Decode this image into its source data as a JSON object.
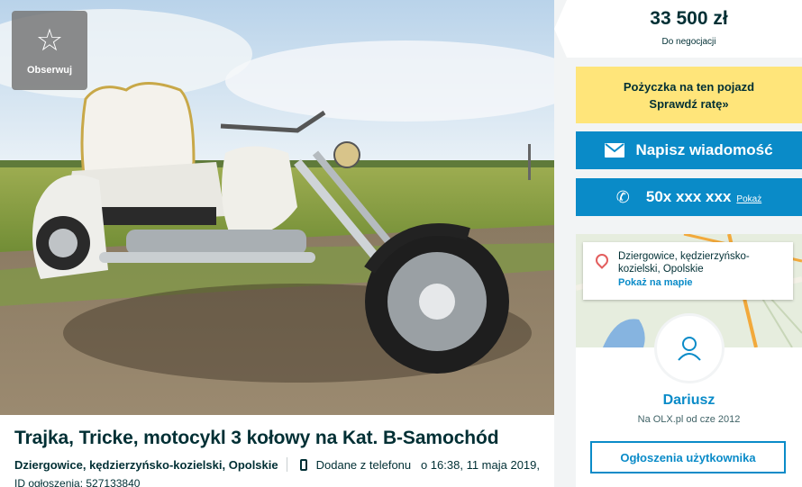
{
  "photo": {
    "observe_label": "Obserwuj",
    "observe_icon": "star-icon"
  },
  "listing": {
    "title": "Trajka, Tricke, motocykl 3 kołowy na Kat. B-Samochód",
    "location": "Dziergowice, kędzierzyńsko-kozielski, Opolskie",
    "added": "Dodane z telefonu   o 16:38, 11 maja 2019,",
    "id_label": "ID ogłoszenia: 527133840"
  },
  "price": {
    "value": "33 500 zł",
    "note": "Do negocjacji"
  },
  "loan": {
    "line1": "Pożyczka na ten pojazd",
    "line2": "Sprawdź ratę»"
  },
  "contact": {
    "message_label": "Napisz wiadomość",
    "phone_masked": "50x xxx xxx",
    "phone_show": "Pokaż"
  },
  "seller": {
    "location_line": "Dziergowice, kędzierzyńsko-kozielski, Opolskie",
    "map_link": "Pokaż na mapie",
    "name": "Dariusz",
    "since": "Na OLX.pl od cze 2012",
    "ads_button": "Ogłoszenia użytkownika"
  },
  "colors": {
    "accent": "#0a8bc8",
    "loan_bg": "#ffe57a",
    "text": "#002f34"
  }
}
